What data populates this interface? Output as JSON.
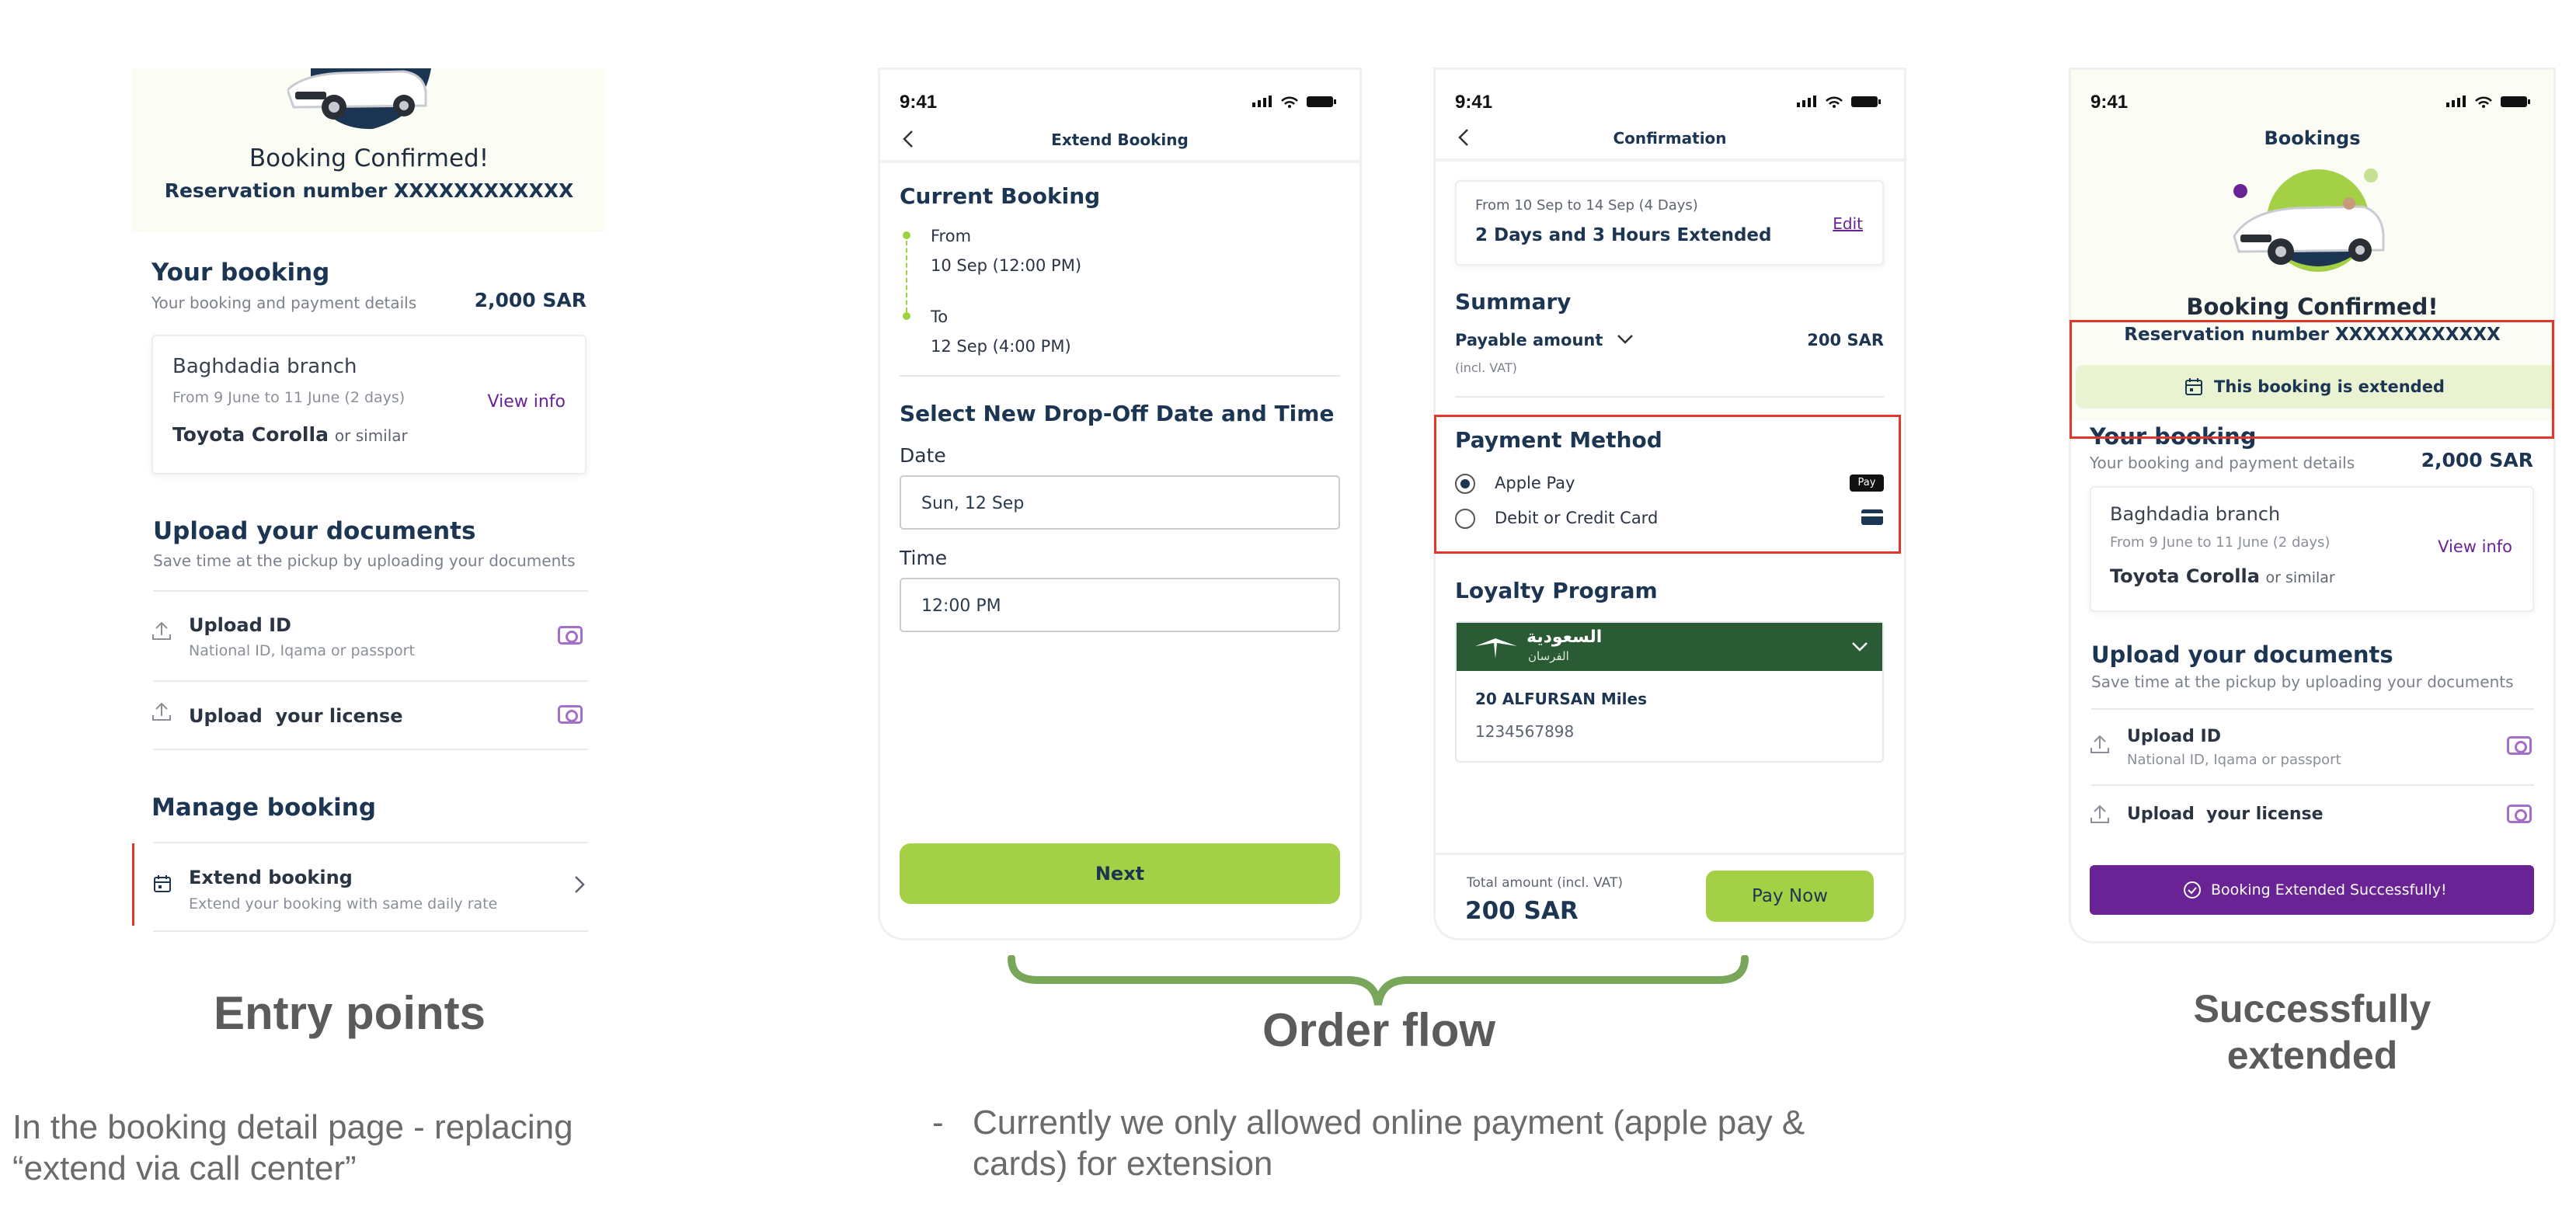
{
  "screen1": {
    "booking_confirmed": "Booking Confirmed!",
    "reservation": "Reservation number XXXXXXXXXXXX",
    "your_booking": "Your booking",
    "payment_details": "Your booking and payment details",
    "amount": "2,000 SAR",
    "branch": "Baghdadia branch",
    "dates": "From 9 June to 11 June (2 days)",
    "view_info": "View info",
    "car": "Toyota Corolla",
    "or_similar": "or similar",
    "upload_title": "Upload your documents",
    "upload_sub": "Save time at the pickup by uploading your documents",
    "upload_id": "Upload ID",
    "upload_id_sub": "National ID, Iqama or passport",
    "upload_license": "Upload  your license",
    "manage": "Manage booking",
    "extend": "Extend booking",
    "extend_sub": "Extend your booking with same daily rate"
  },
  "screen2": {
    "time": "9:41",
    "title": "Extend Booking",
    "current": "Current Booking",
    "from_label": "From",
    "from_val": "10 Sep (12:00 PM)",
    "to_label": "To",
    "to_val": "12 Sep (4:00 PM)",
    "select_title": "Select New Drop-Off Date and Time",
    "date_label": "Date",
    "date_val": "Sun, 12 Sep",
    "time_label": "Time",
    "time_val": "12:00 PM",
    "next": "Next"
  },
  "screen3": {
    "time": "9:41",
    "title": "Confirmation",
    "range": "From 10 Sep to 14 Sep (4 Days)",
    "extended": "2 Days and 3 Hours Extended",
    "edit": "Edit",
    "summary": "Summary",
    "payable": "Payable amount",
    "payable_amount": "200 SAR",
    "incl_vat": "(incl. VAT)",
    "payment_method": "Payment Method",
    "apple_pay": "Apple Pay",
    "apple_badge": "Pay",
    "debit": "Debit or Credit Card",
    "loyalty": "Loyalty Program",
    "loyalty_brand": "السعودية",
    "loyalty_brand_sub": "الفرسان",
    "miles": "20 ALFURSAN Miles",
    "member_no": "1234567898",
    "total_label": "Total amount (incl. VAT)",
    "total": "200 SAR",
    "pay_now": "Pay Now"
  },
  "screen4": {
    "time": "9:41",
    "title": "Bookings",
    "booking_confirmed": "Booking Confirmed!",
    "reservation": "Reservation number XXXXXXXXXXXX",
    "extended_badge": "This booking is extended",
    "your_booking": "Your booking",
    "payment_details": "Your booking and payment details",
    "amount": "2,000 SAR",
    "branch": "Baghdadia branch",
    "dates": "From 9 June to 11 June (2 days)",
    "view_info": "View info",
    "car": "Toyota Corolla",
    "or_similar": "or similar",
    "upload_title": "Upload your documents",
    "upload_sub": "Save time at the pickup by uploading your documents",
    "upload_id": "Upload ID",
    "upload_id_sub": "National ID, Iqama or passport",
    "upload_license": "Upload  your license",
    "toast": "Booking Extended Successfully!"
  },
  "captions": {
    "entry": "Entry points",
    "order": "Order flow",
    "success_line1": "Successfully",
    "success_line2": "extended",
    "entry_note_line1": "In the booking detail page - replacing",
    "entry_note_line2": "“extend via call center”",
    "order_note_dash": "-",
    "order_note_line1": "Currently we only allowed online payment (apple pay &",
    "order_note_line2": "cards) for extension"
  },
  "colors": {
    "navy": "#1c3553",
    "green": "#a3d045",
    "purple": "#6a2394",
    "red_highlight": "#e0362c",
    "brace_green": "#79a75a",
    "saudia_green": "#2a5b34"
  }
}
